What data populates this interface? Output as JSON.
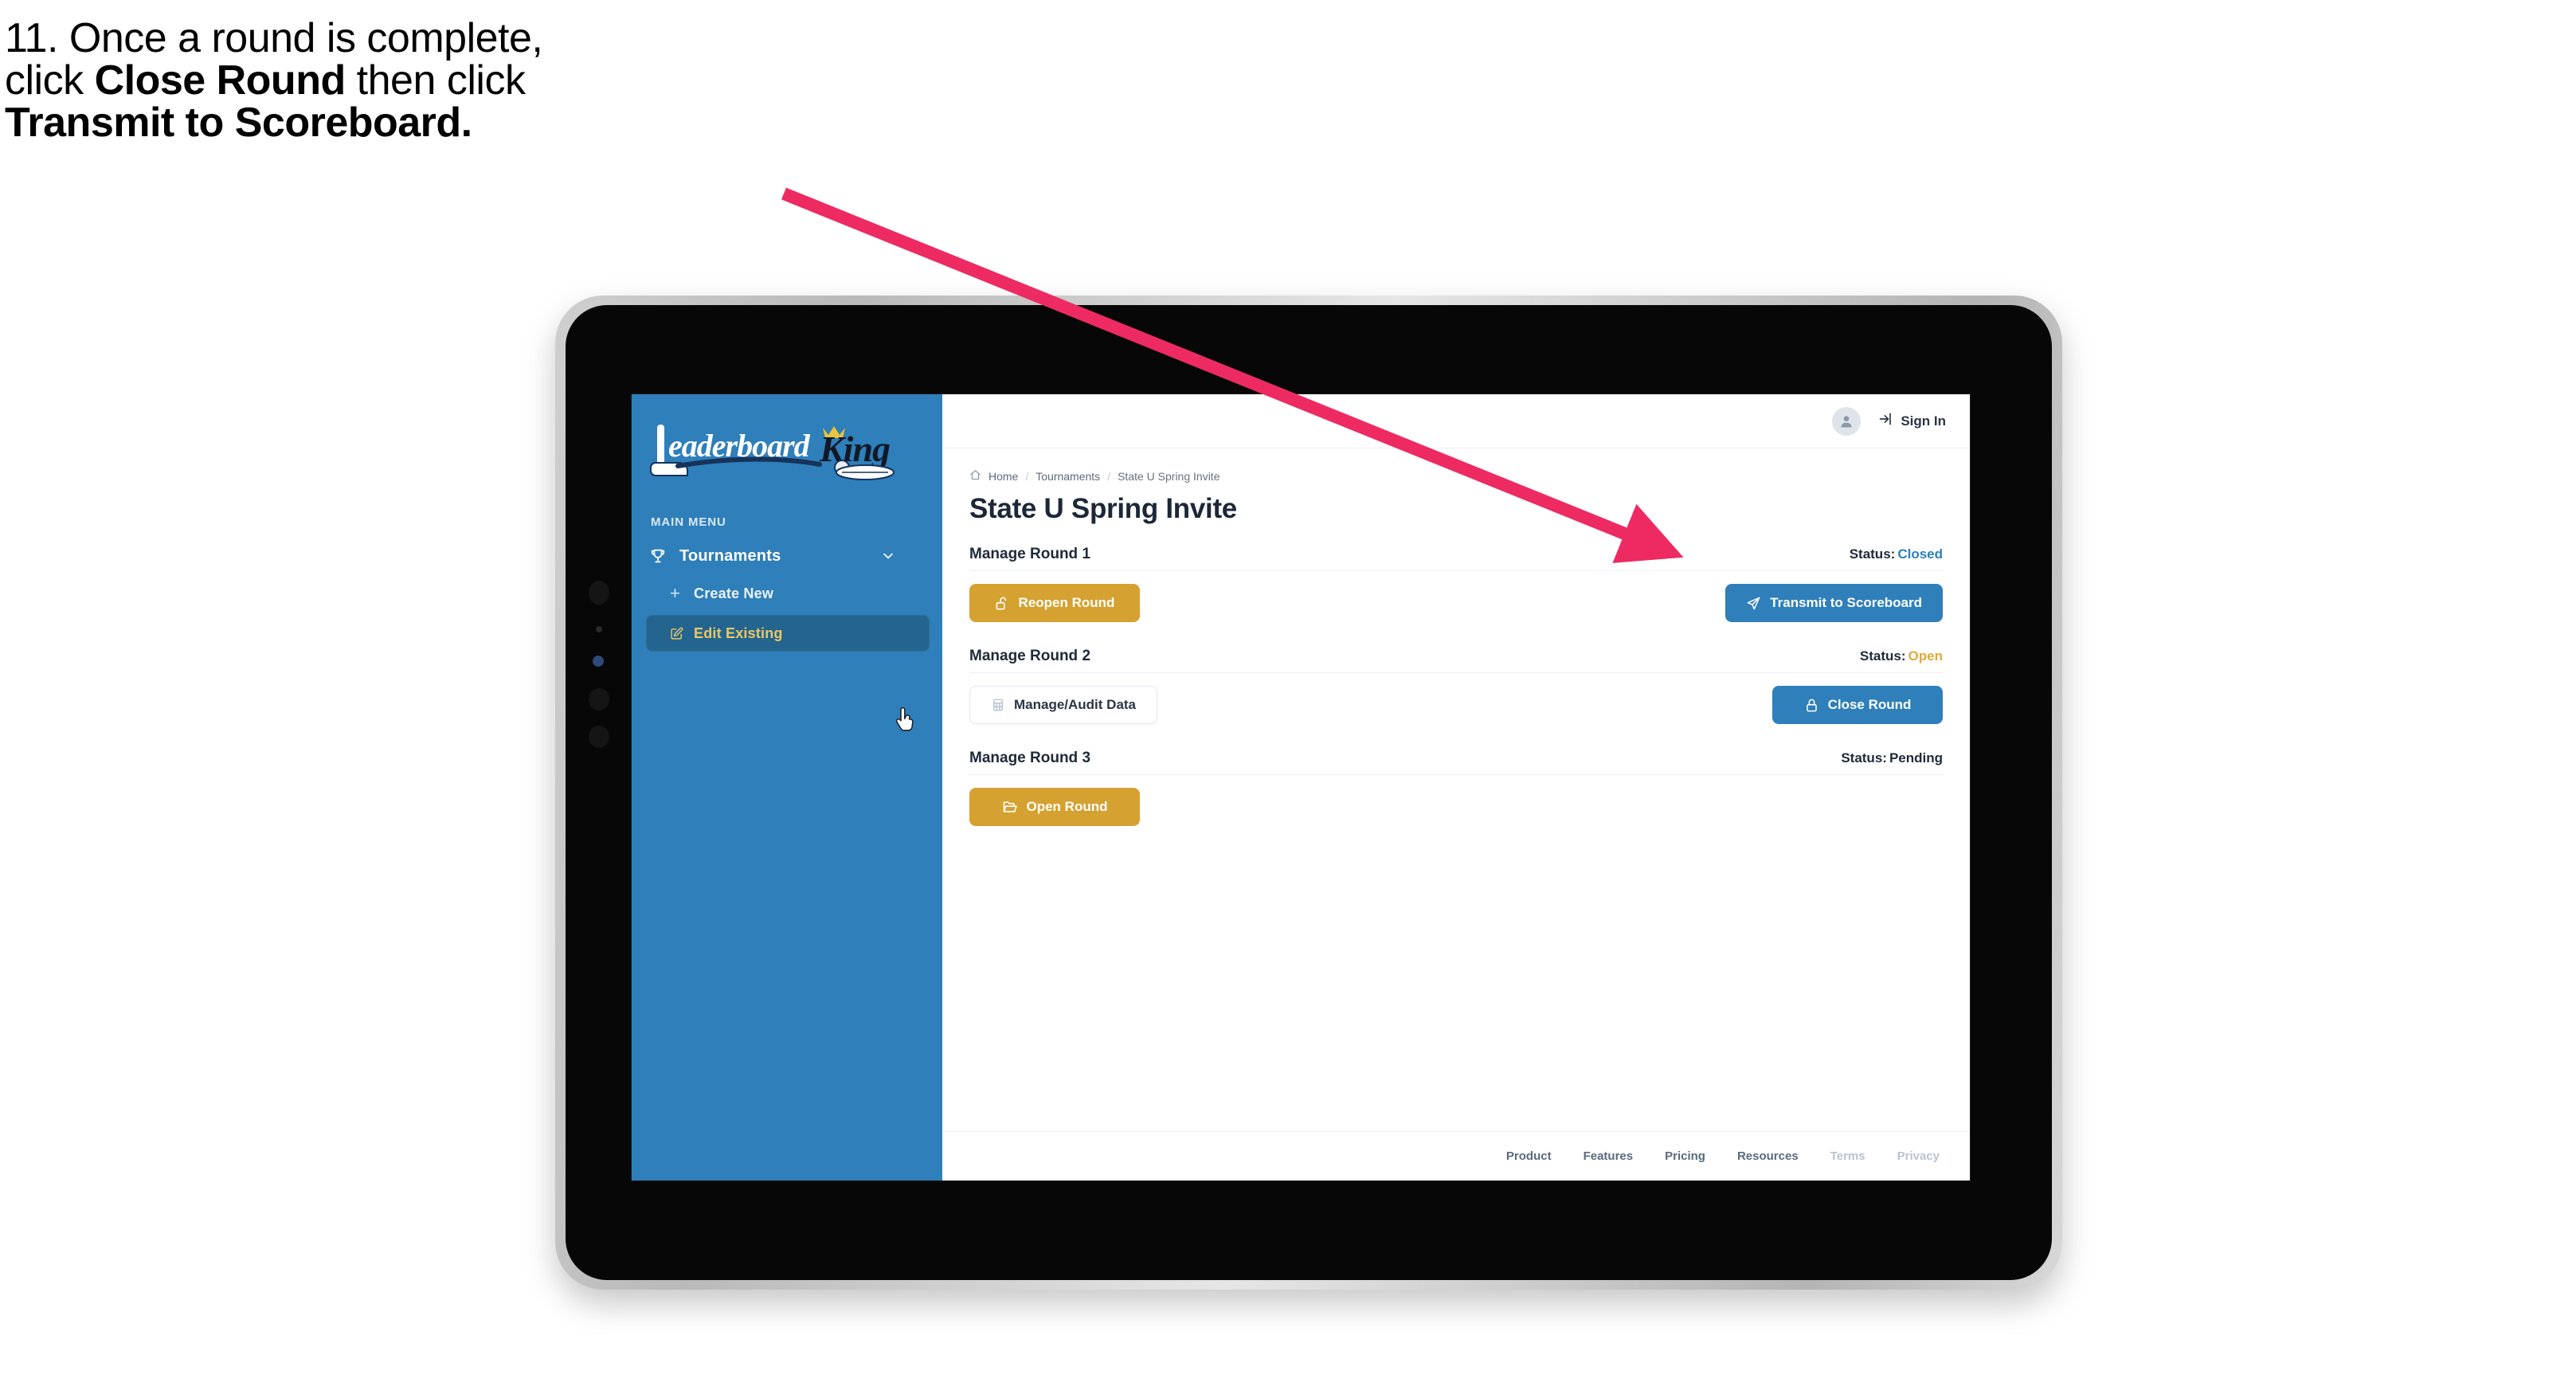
{
  "caption": {
    "line1": "11. Once a round is complete,",
    "line2_pre": "click ",
    "line2_bold": "Close Round",
    "line2_post": " then click",
    "line3_bold": "Transmit to Scoreboard."
  },
  "annotation": {
    "arrow_color": "#ED2B62",
    "points_to": "Transmit to Scoreboard"
  },
  "sidebar": {
    "logo_primary": "Leaderboard",
    "logo_secondary": "King",
    "menu_label": "MAIN MENU",
    "nav": {
      "label": "Tournaments",
      "icon": "trophy-icon",
      "chevron": "chevron-down-icon"
    },
    "items": [
      {
        "label": "Create New",
        "icon": "plus-icon",
        "active": false
      },
      {
        "label": "Edit Existing",
        "icon": "pencil-square-icon",
        "active": true
      }
    ],
    "bg_color": "#2E7FBA",
    "active_bg_color": "#24658F",
    "active_text_color": "#E9C768"
  },
  "topbar": {
    "avatar_icon": "user-avatar-icon",
    "signin_icon": "login-arrow-icon",
    "signin_label": "Sign In"
  },
  "breadcrumb": {
    "home_icon": "home-icon",
    "items": [
      "Home",
      "Tournaments",
      "State U Spring Invite"
    ],
    "separator": "/"
  },
  "page": {
    "title": "State U Spring Invite"
  },
  "rounds": [
    {
      "title": "Manage Round 1",
      "status_label": "Status:",
      "status_value": "Closed",
      "status_color": "#2E7FBA",
      "left_button": {
        "label": "Reopen Round",
        "icon": "unlock-icon",
        "style": "amber"
      },
      "right_button": {
        "label": "Transmit to Scoreboard",
        "icon": "paper-plane-icon",
        "style": "blue"
      }
    },
    {
      "title": "Manage Round 2",
      "status_label": "Status:",
      "status_value": "Open",
      "status_color": "#E0A93B",
      "left_button": {
        "label": "Manage/Audit Data",
        "icon": "table-grid-icon",
        "style": "ghost"
      },
      "right_button": {
        "label": "Close Round",
        "icon": "lock-icon",
        "style": "blue"
      }
    },
    {
      "title": "Manage Round 3",
      "status_label": "Status:",
      "status_value": "Pending",
      "status_color": "#1F2A3A",
      "left_button": {
        "label": "Open Round",
        "icon": "open-folder-icon",
        "style": "amber"
      },
      "right_button": null
    }
  ],
  "footer": {
    "links": [
      {
        "label": "Product",
        "muted": false
      },
      {
        "label": "Features",
        "muted": false
      },
      {
        "label": "Pricing",
        "muted": false
      },
      {
        "label": "Resources",
        "muted": false
      },
      {
        "label": "Terms",
        "muted": true
      },
      {
        "label": "Privacy",
        "muted": true
      }
    ]
  },
  "cursor": {
    "type": "pointing-hand-cursor",
    "over": "Edit Existing"
  }
}
